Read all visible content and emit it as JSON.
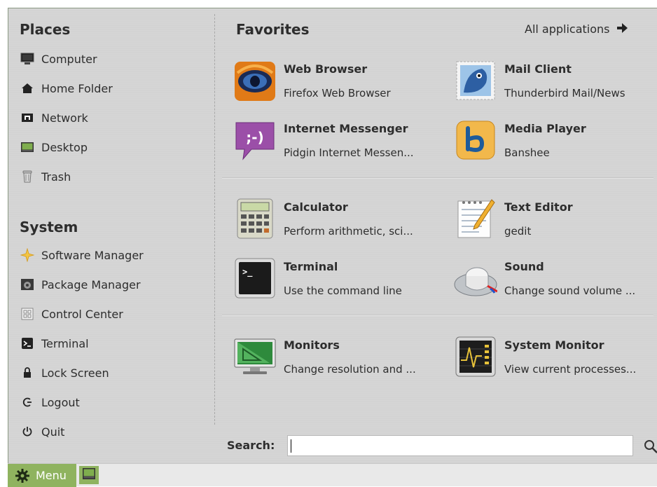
{
  "places": {
    "title": "Places",
    "items": [
      {
        "label": "Computer",
        "icon": "computer-icon"
      },
      {
        "label": "Home Folder",
        "icon": "home-icon"
      },
      {
        "label": "Network",
        "icon": "network-icon"
      },
      {
        "label": "Desktop",
        "icon": "desktop-icon"
      },
      {
        "label": "Trash",
        "icon": "trash-icon"
      }
    ]
  },
  "system": {
    "title": "System",
    "items": [
      {
        "label": "Software Manager",
        "icon": "software-manager-icon"
      },
      {
        "label": "Package Manager",
        "icon": "package-manager-icon"
      },
      {
        "label": "Control Center",
        "icon": "control-center-icon"
      },
      {
        "label": "Terminal",
        "icon": "terminal-icon"
      },
      {
        "label": "Lock Screen",
        "icon": "lock-icon"
      },
      {
        "label": "Logout",
        "icon": "logout-icon"
      },
      {
        "label": "Quit",
        "icon": "power-icon"
      }
    ]
  },
  "favorites": {
    "title": "Favorites",
    "all_apps_label": "All applications",
    "items": [
      {
        "name": "Web Browser",
        "desc": "Firefox Web Browser",
        "icon": "firefox-icon"
      },
      {
        "name": "Mail Client",
        "desc": "Thunderbird Mail/News",
        "icon": "thunderbird-icon"
      },
      {
        "name": "Internet Messenger",
        "desc": "Pidgin Internet Messen...",
        "icon": "pidgin-icon"
      },
      {
        "name": "Media Player",
        "desc": "Banshee",
        "icon": "banshee-icon"
      },
      {
        "name": "Calculator",
        "desc": "Perform arithmetic, sci...",
        "icon": "calculator-icon"
      },
      {
        "name": "Text Editor",
        "desc": "gedit",
        "icon": "text-editor-icon"
      },
      {
        "name": "Terminal",
        "desc": "Use the command line",
        "icon": "terminal-icon"
      },
      {
        "name": "Sound",
        "desc": "Change sound volume ...",
        "icon": "sound-icon"
      },
      {
        "name": "Monitors",
        "desc": "Change resolution and ...",
        "icon": "monitors-icon"
      },
      {
        "name": "System Monitor",
        "desc": "View current processes...",
        "icon": "system-monitor-icon"
      }
    ]
  },
  "search": {
    "label": "Search:",
    "value": "",
    "placeholder": ""
  },
  "taskbar": {
    "menu_label": "Menu"
  },
  "colors": {
    "accent": "#8fb35f",
    "panel": "#d4d4d4",
    "text": "#2d2d2d"
  }
}
